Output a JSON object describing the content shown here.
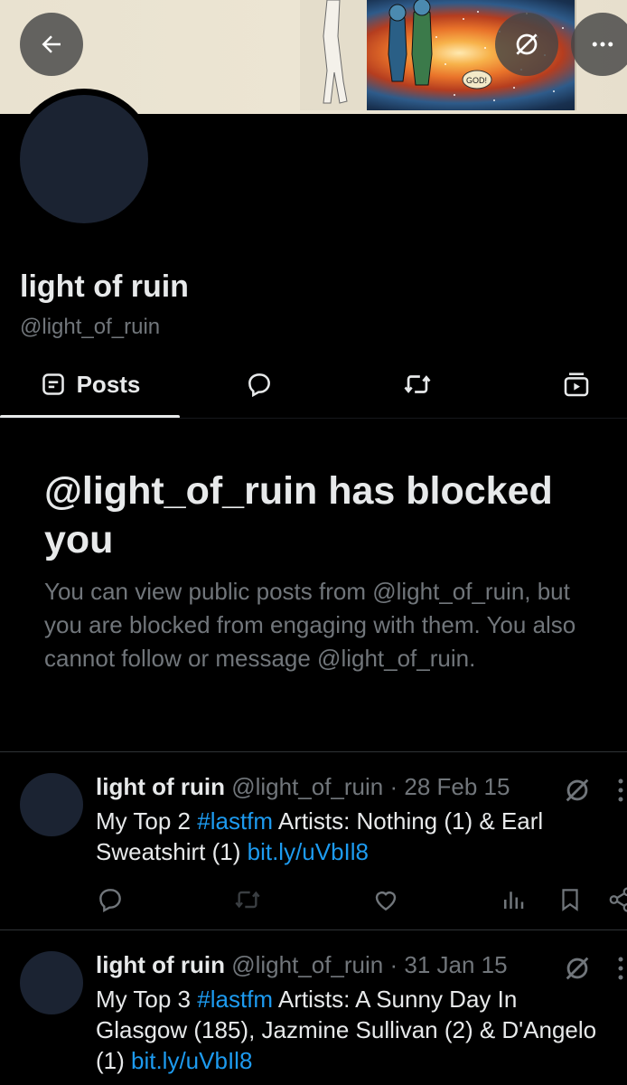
{
  "profile": {
    "name": "light of ruin",
    "handle": "@light_of_ruin"
  },
  "banner": {
    "art_caption": "GOD!",
    "icons": [
      "back-arrow-icon",
      "grok-slash-icon",
      "more-icon"
    ]
  },
  "tabs": [
    {
      "label": "Posts",
      "icon": "posts-icon",
      "active": true
    },
    {
      "label": "",
      "icon": "reply-bubble-icon",
      "active": false
    },
    {
      "label": "",
      "icon": "repost-icon",
      "active": false
    },
    {
      "label": "",
      "icon": "media-icon",
      "active": false
    }
  ],
  "blocked": {
    "title": "@light_of_ruin has blocked you",
    "description": "You can view public posts from @light_of_ruin, but you are blocked from engaging with them. You also cannot follow or message @light_of_ruin."
  },
  "posts": [
    {
      "author": "light of ruin",
      "handle_date": "@light_of_ruin · 28 Feb 15",
      "line1_prefix": "My Top 2 ",
      "hashtag": "#lastfm",
      "line1_suffix": " Artists: Nothing (1) & Earl",
      "line2_prefix": "Sweatshirt (1) ",
      "link": "bit.ly/uVbIl8"
    },
    {
      "author": "light of ruin",
      "handle_date": "@light_of_ruin · 31 Jan 15",
      "line1_prefix": "My Top 3 ",
      "hashtag": "#lastfm",
      "line1_suffix": " Artists: A Sunny Day In",
      "line2_text": "Glasgow (185), Jazmine Sullivan (2) & D'Angelo",
      "line3_prefix": "(1) ",
      "link": "bit.ly/uVbIl8"
    }
  ],
  "colors": {
    "background": "#000000",
    "text": "#e7e9ea",
    "muted": "#71767b",
    "link": "#1d9bf0",
    "avatar": "#1b2332"
  }
}
